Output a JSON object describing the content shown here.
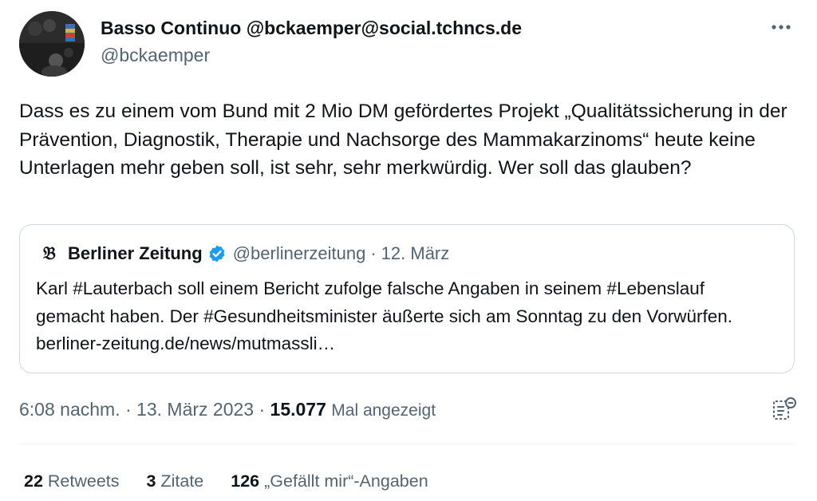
{
  "author": {
    "display_name": "Basso Continuo @bckaemper@social.tchncs.de",
    "handle": "@bckaemper"
  },
  "more_icon": "ellipsis-icon",
  "tweet": {
    "text": "Dass es zu einem vom Bund mit 2 Mio DM gefördertes Projekt „Qualitätssicherung in der Prävention, Diagnostik, Therapie und Nachsorge des Mammakarzinoms“ heute keine Unterlagen mehr geben soll, ist sehr, sehr merkwürdig. Wer soll das glauben?"
  },
  "quote": {
    "logo_glyph": "𝔅",
    "name": "Berliner Zeitung",
    "verified_icon": "verified-badge-icon",
    "handle": "@berlinerzeitung",
    "separator": "·",
    "date": "12. März",
    "text": "Karl #Lauterbach soll einem Bericht zufolge falsche Angaben in seinem #Lebenslauf gemacht haben. Der #Gesundheitsminister äußerte sich am Sonntag zu den Vorwürfen. berliner-zeitung.de/news/mutmassli…"
  },
  "meta": {
    "time": "6:08 nachm.",
    "sep1": " · ",
    "date": "13. März 2023",
    "sep2": " · ",
    "views_count": "15.077",
    "views_label": "Mal angezeigt",
    "analytics_icon": "analytics-icon"
  },
  "stats": {
    "retweets_count": "22",
    "retweets_label": "Retweets",
    "quotes_count": "3",
    "quotes_label": "Zitate",
    "likes_count": "126",
    "likes_label": "„Gefällt mir“-Angaben"
  },
  "colors": {
    "text": "#0f1419",
    "secondary": "#536471",
    "border": "#cfd9de",
    "verified": "#1d9bf0"
  }
}
